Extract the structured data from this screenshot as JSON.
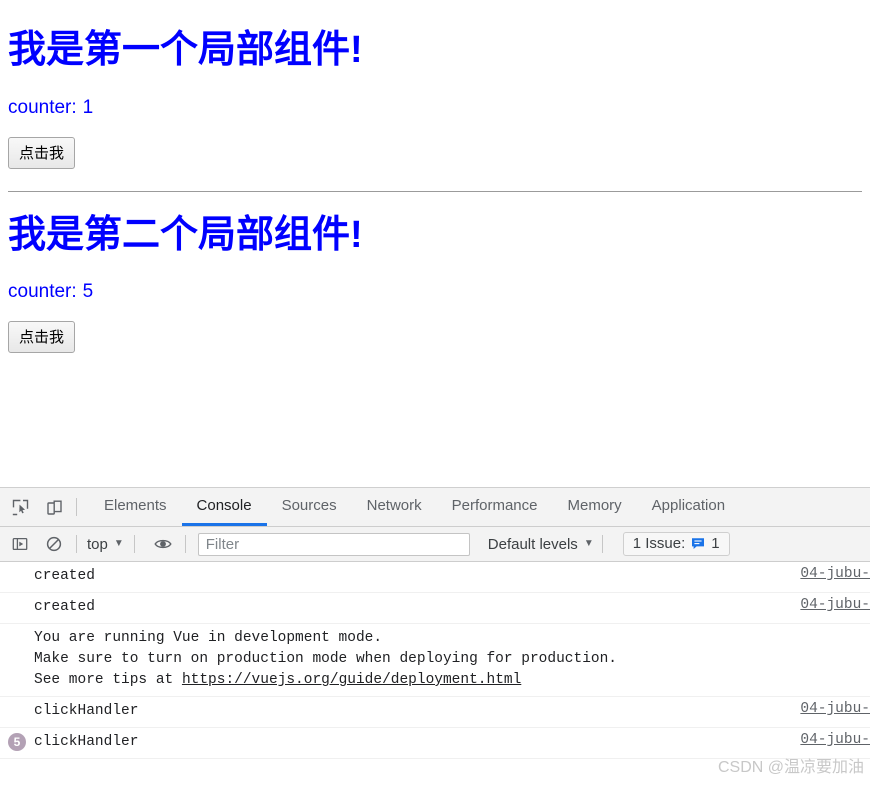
{
  "page": {
    "components": [
      {
        "title": "我是第一个局部组件!",
        "counter_label": "counter:",
        "counter_value": "1",
        "button_label": "点击我"
      },
      {
        "title": "我是第二个局部组件!",
        "counter_label": "counter:",
        "counter_value": "5",
        "button_label": "点击我"
      }
    ],
    "text_color": "#0000ff"
  },
  "devtools": {
    "toolbar_icons": [
      {
        "name": "inspect-element-icon"
      },
      {
        "name": "device-toolbar-icon"
      }
    ],
    "tabs": [
      {
        "label": "Elements",
        "active": false
      },
      {
        "label": "Console",
        "active": true
      },
      {
        "label": "Sources",
        "active": false
      },
      {
        "label": "Network",
        "active": false
      },
      {
        "label": "Performance",
        "active": false
      },
      {
        "label": "Memory",
        "active": false
      },
      {
        "label": "Application",
        "active": false
      }
    ],
    "active_tab_accent": "#1a73e8",
    "filter_bar": {
      "sidebar_toggle_icon": "console-sidebar-icon",
      "clear_console_icon": "clear-console-icon",
      "context_label": "top",
      "eye_icon": "live-expression-eye-icon",
      "filter_value": "",
      "filter_placeholder": "Filter",
      "levels_label": "Default levels",
      "issues_label": "1 Issue:",
      "issues_icon": "issue-message-icon",
      "issues_count": "1",
      "issues_icon_color": "#1a73e8"
    },
    "console_messages": [
      {
        "repeat": "",
        "text": "created",
        "source": "04-jubu-"
      },
      {
        "repeat": "",
        "text": "created",
        "source": "04-jubu-"
      },
      {
        "repeat": "",
        "line1": "You are running Vue in development mode.",
        "line2": "Make sure to turn on production mode when deploying for production.",
        "line3_prefix": "See more tips at ",
        "link": "https://vuejs.org/guide/deployment.html",
        "source": ""
      },
      {
        "repeat": "",
        "text": "clickHandler",
        "source": "04-jubu-"
      },
      {
        "repeat": "5",
        "text": "clickHandler",
        "source": "04-jubu-"
      }
    ]
  },
  "watermark": "CSDN @温凉要加油"
}
